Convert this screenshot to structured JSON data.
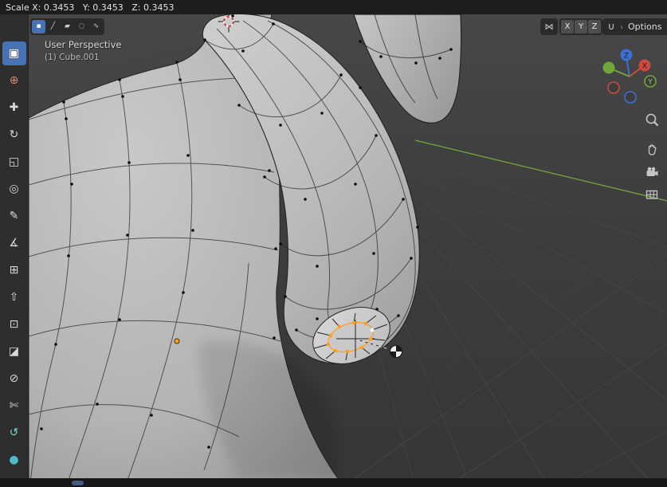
{
  "colors": {
    "accent": "#4772b3",
    "selection": "#ff9d23",
    "active_vertex": "#ffffff",
    "axis_x": "#cc4b3f",
    "axis_y": "#6fa838",
    "axis_z": "#3b6fd2",
    "grid_green": "#76a93e",
    "origin": "#ff9d23"
  },
  "topbar": {
    "transform_status": "Scale X: 0.3453   Y: 0.3453   Z: 0.3453"
  },
  "viewport_header": {
    "select_modes": [
      {
        "name": "vertex-select",
        "glyph": "▪"
      },
      {
        "name": "edge-select",
        "glyph": "╱"
      },
      {
        "name": "face-select",
        "glyph": "▰"
      },
      {
        "name": "proportional-editing",
        "glyph": "◌"
      },
      {
        "name": "proportional-falloff",
        "glyph": "∿"
      }
    ],
    "symmetry_glyph": "⋈",
    "mirror_axes": [
      "X",
      "Y",
      "Z"
    ],
    "snap_glyph": "∩",
    "caret": "∨",
    "options_label": "Options"
  },
  "toolbar": {
    "tools": [
      {
        "name": "select-box",
        "glyph": "▣"
      },
      {
        "name": "cursor",
        "glyph": "⊕",
        "color": "#d98a7a"
      },
      {
        "name": "move",
        "glyph": "✚"
      },
      {
        "name": "rotate",
        "glyph": "↻"
      },
      {
        "name": "scale",
        "glyph": "◱"
      },
      {
        "name": "transform",
        "glyph": "◎"
      },
      {
        "name": "annotate",
        "glyph": "✎"
      },
      {
        "name": "measure",
        "glyph": "∡"
      },
      {
        "name": "add-cube",
        "glyph": "⊞"
      },
      {
        "name": "extrude-region",
        "glyph": "⇧"
      },
      {
        "name": "inset-faces",
        "glyph": "⊡"
      },
      {
        "name": "bevel",
        "glyph": "◪"
      },
      {
        "name": "loop-cut",
        "glyph": "⊘"
      },
      {
        "name": "knife",
        "glyph": "✄"
      },
      {
        "name": "spin",
        "glyph": "↺",
        "color": "#7fd0d6"
      },
      {
        "name": "smooth",
        "glyph": "●",
        "color": "#4fb9c9"
      }
    ]
  },
  "viewport": {
    "view_label": "User Perspective",
    "object_label": "(1) Cube.001",
    "gizmo_axes": {
      "x": "X",
      "y": "Y",
      "z": "Z"
    }
  }
}
